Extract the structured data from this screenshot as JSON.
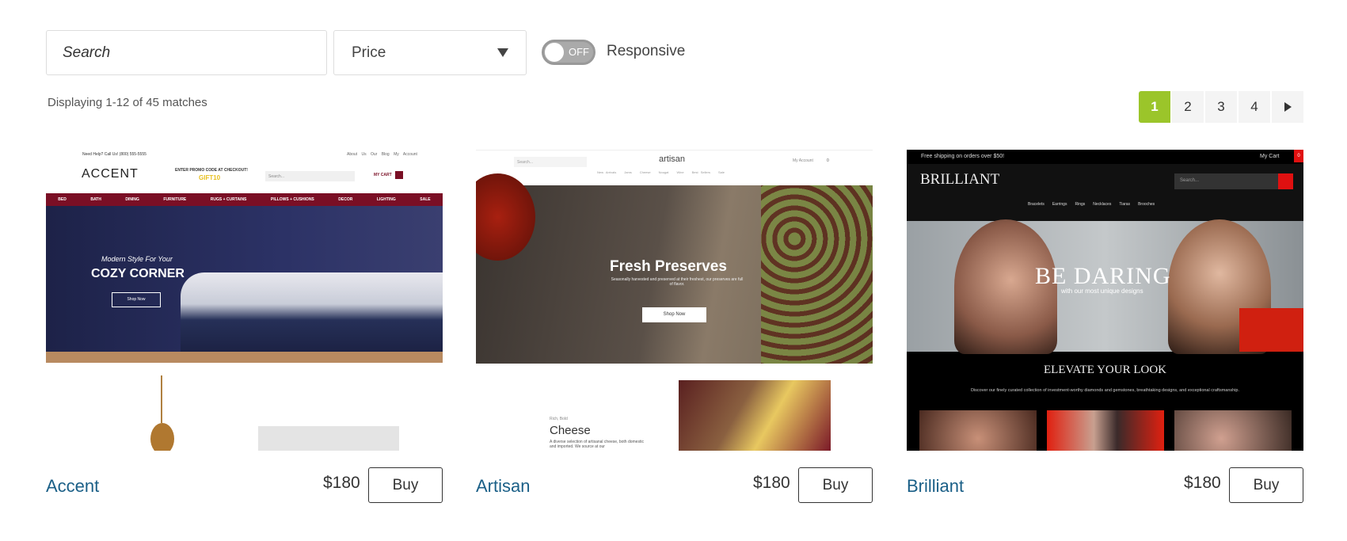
{
  "filters": {
    "search_placeholder": "Search",
    "price_label": "Price",
    "toggle_state": "OFF",
    "toggle_label": "Responsive"
  },
  "results": {
    "summary": "Displaying 1-12 of 45 matches"
  },
  "pagination": {
    "pages": [
      "1",
      "2",
      "3",
      "4"
    ],
    "active": "1"
  },
  "colors": {
    "accent": "#9bc52a",
    "link": "#1a5f87"
  },
  "products": [
    {
      "name": "Accent",
      "price": "$180",
      "buy": "Buy",
      "thumb": {
        "help": "Need Help? Call Us! (800) 555-5555",
        "links": [
          "About Us",
          "Our Blog",
          "My Account"
        ],
        "logo": "ACCENT",
        "promo": "ENTER PROMO CODE AT CHECKOUT!",
        "code": "GIFT10",
        "search": "Search...",
        "cart": "MY CART",
        "nav": [
          "BED",
          "BATH",
          "DINING",
          "FURNITURE",
          "RUGS + CURTAINS",
          "PILLOWS + CUSHIONS",
          "DECOR",
          "LIGHTING",
          "SALE"
        ],
        "kicker": "Modern Style For Your",
        "headline": "COZY CORNER",
        "cta": "Shop Now"
      }
    },
    {
      "name": "Artisan",
      "price": "$180",
      "buy": "Buy",
      "thumb": {
        "search": "Search...",
        "logo": "artisan",
        "account": "My Account",
        "cart": "0",
        "nav": [
          "New Arrivals",
          "Jams",
          "Cheese",
          "Nougat",
          "Wine",
          "Best Sellers",
          "Sale"
        ],
        "headline": "Fresh Preserves",
        "sub": "Seasonally harvested and preserved at their freshest, our preserves are full of flavor.",
        "cta": "Shop Now",
        "kicker": "Rich, Bold",
        "section": "Cheese",
        "desc": "A diverse selection of artisanal cheese, both domestic and imported. We source at our"
      }
    },
    {
      "name": "Brilliant",
      "price": "$180",
      "buy": "Buy",
      "thumb": {
        "ship": "Free shipping on orders over $50!",
        "cart": "My Cart",
        "cart_count": "0",
        "logo": "BRILLIANT",
        "search": "Search...",
        "nav": [
          "Bracelets",
          "Earrings",
          "Rings",
          "Necklaces",
          "Tiaras",
          "Brooches"
        ],
        "headline": "BE DARING",
        "sub": "with our most unique designs",
        "section": "ELEVATE YOUR LOOK",
        "desc": "Discover our finely curated collection of investment-worthy diamonds and gemstones, breathtaking designs, and exceptional craftsmanship."
      }
    }
  ]
}
